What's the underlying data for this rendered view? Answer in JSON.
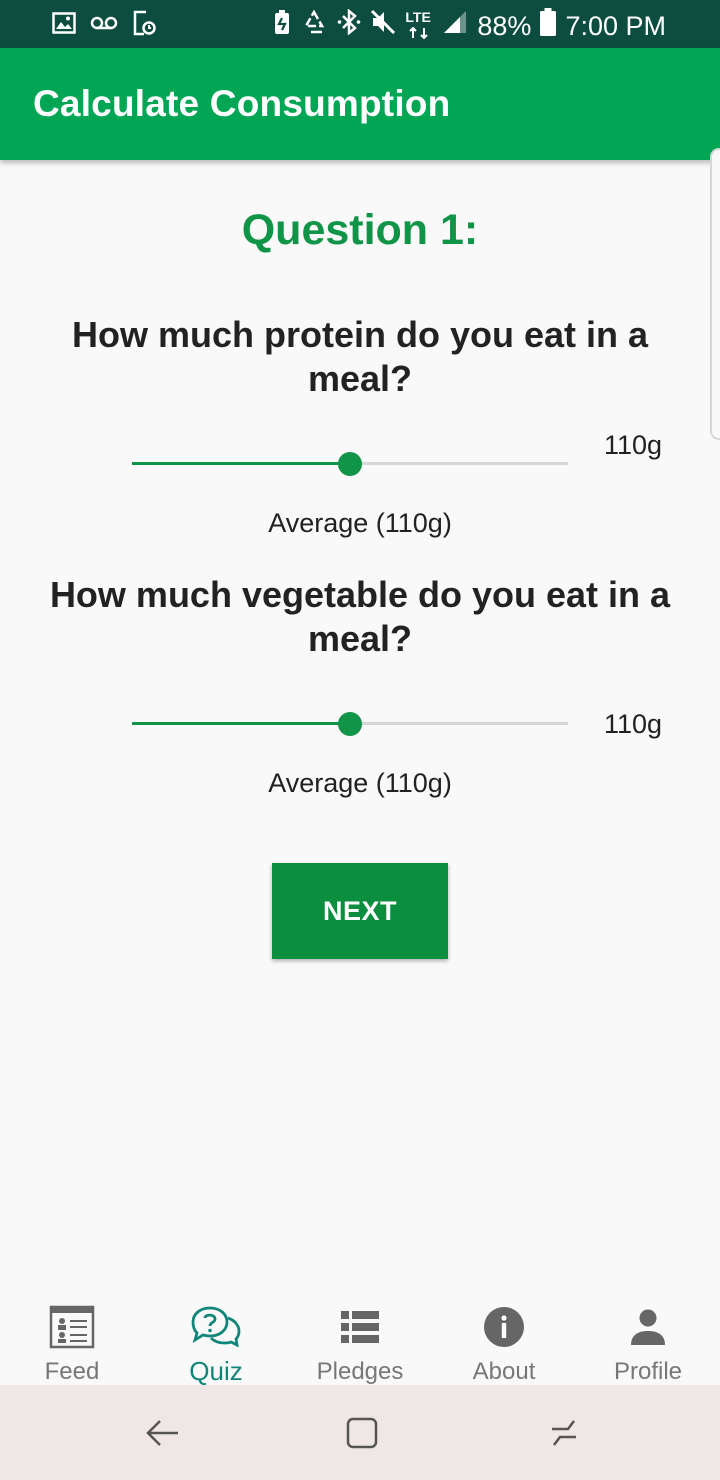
{
  "status_bar": {
    "left_icons": [
      "image-icon",
      "voicemail-icon",
      "screen-recording-icon"
    ],
    "right_icons": [
      "battery-saver-icon",
      "recycle-icon",
      "bluetooth-icon",
      "mute-icon",
      "lte-icon",
      "signal-icon",
      "battery-icon"
    ],
    "lte_label": "LTE",
    "battery": "88%",
    "time": "7:00 PM"
  },
  "app_bar": {
    "title": "Calculate Consumption"
  },
  "quiz": {
    "title": "Question 1:",
    "questions": [
      {
        "label": "How much protein do you eat in a meal?",
        "value_text": "110g",
        "caption": "Average (110g)",
        "fraction": 0.5
      },
      {
        "label": "How much vegetable do you eat in a meal?",
        "value_text": "110g",
        "caption": "Average (110g)",
        "fraction": 0.5
      }
    ],
    "next_label": "NEXT"
  },
  "bottom_nav": {
    "items": [
      {
        "label": "Feed",
        "icon": "feed-icon",
        "active": false
      },
      {
        "label": "Quiz",
        "icon": "quiz-icon",
        "active": true
      },
      {
        "label": "Pledges",
        "icon": "list-icon",
        "active": false
      },
      {
        "label": "About",
        "icon": "info-icon",
        "active": false
      },
      {
        "label": "Profile",
        "icon": "person-icon",
        "active": false
      }
    ]
  },
  "system_nav": {
    "icons": [
      "back-icon",
      "home-icon",
      "recents-icon"
    ]
  },
  "colors": {
    "status_bar": "#0c4d3f",
    "app_bar": "#00a653",
    "accent": "#109447",
    "active_nav": "#11857a",
    "button": "#0b8e3d"
  }
}
